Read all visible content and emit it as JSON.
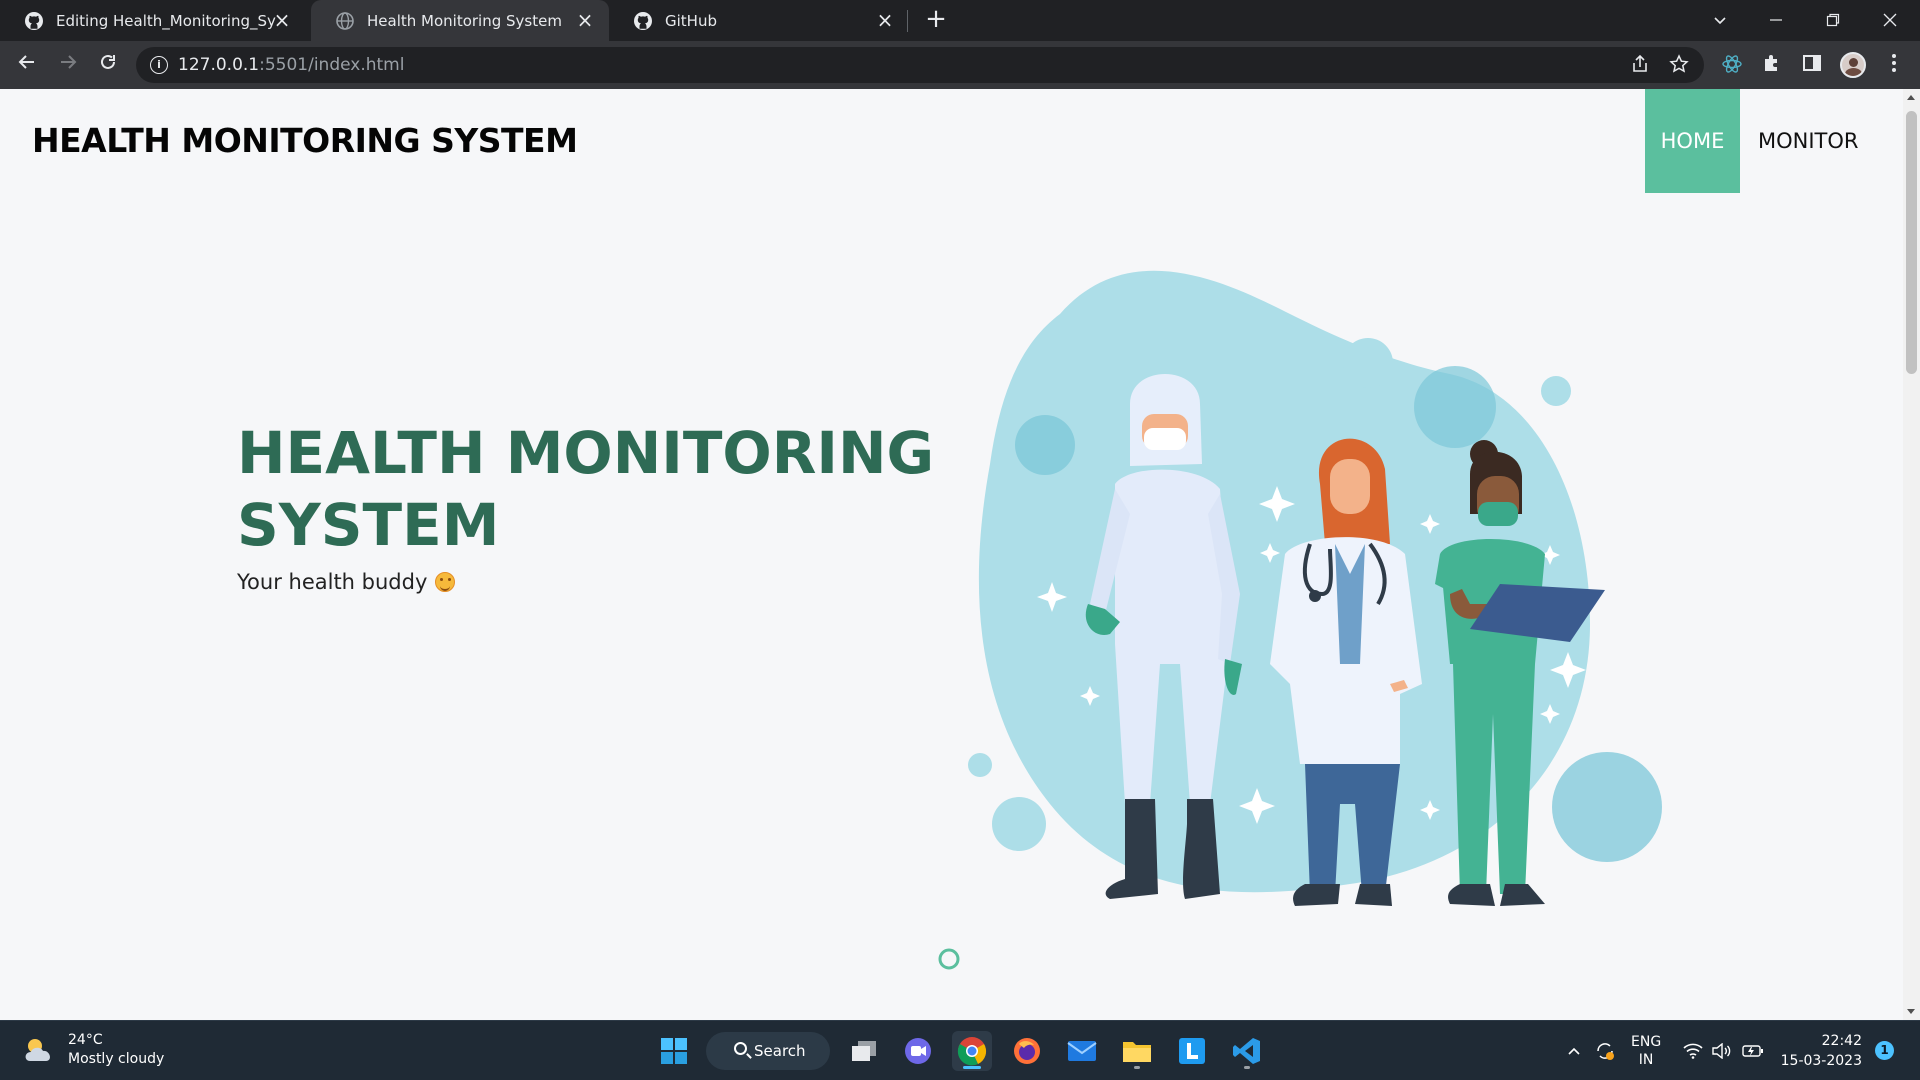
{
  "browser": {
    "tabs": [
      {
        "title": "Editing Health_Monitoring_Syster",
        "icon": "github-icon",
        "active": false
      },
      {
        "title": "Health Monitoring System",
        "icon": "globe-icon",
        "active": true
      },
      {
        "title": "GitHub",
        "icon": "github-icon",
        "active": false
      }
    ],
    "url_host": "127.0.0.1",
    "url_path": ":5501/index.html"
  },
  "page": {
    "brand": "HEALTH MONITORING SYSTEM",
    "nav": {
      "home": "HOME",
      "monitor": "MONITOR"
    },
    "hero": {
      "title_line1": "HEALTH MONITORING",
      "title_line2": "SYSTEM",
      "subtitle": "Your health buddy"
    },
    "colors": {
      "accent": "#5bbf9e",
      "heading": "#2e6b55",
      "blob": "#addee8"
    }
  },
  "taskbar": {
    "weather": {
      "temp": "24°C",
      "condition": "Mostly cloudy"
    },
    "search_label": "Search",
    "language": {
      "line1": "ENG",
      "line2": "IN"
    },
    "time": "22:42",
    "date": "15-03-2023",
    "notification_count": "1"
  }
}
